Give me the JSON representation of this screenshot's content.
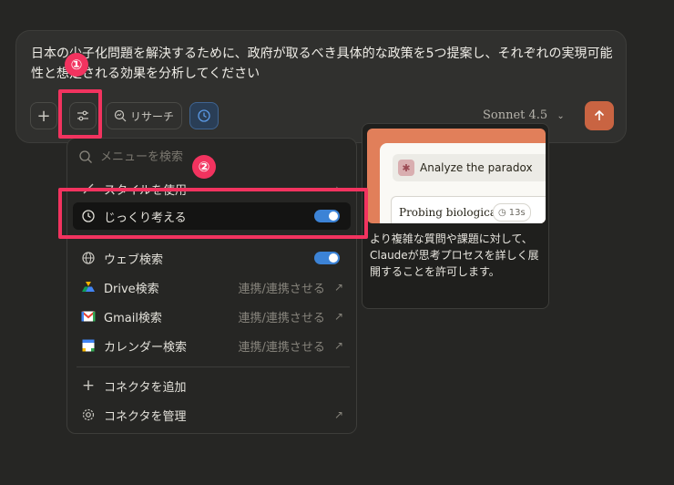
{
  "composer": {
    "prompt": "日本の少子化問題を解決するために、政府が取るべき具体的な政策を5つ提案し、それぞれの実現可能性と想定される効果を分析してください",
    "research_label": "リサーチ",
    "model_label": "Sonnet 4.5"
  },
  "menu": {
    "search_placeholder": "メニューを検索",
    "style_label": "スタイルを使用",
    "extended_thinking_label": "じっくり考える",
    "web_search_label": "ウェブ検索",
    "drive_label": "Drive検索",
    "gmail_label": "Gmail検索",
    "calendar_label": "カレンダー検索",
    "connect_label": "連携/連携させる",
    "add_connector_label": "コネクタを追加",
    "manage_connector_label": "コネクタを管理"
  },
  "tooltip": {
    "chip_text": "Analyze the paradox",
    "probe_text": "Probing biological",
    "timer": "13s",
    "description": "より複雑な質問や課題に対して、Claudeが思考プロセスを詳しく展開することを許可します。"
  },
  "annotations": {
    "badge1": "①",
    "badge2": "②",
    "color": "#f2335f"
  },
  "icons": [
    "plus-icon",
    "sliders-icon",
    "research-icon",
    "clock-icon",
    "chevron-down-icon",
    "arrow-up-icon",
    "search-icon",
    "brush-icon",
    "chevron-right-icon",
    "timer-icon",
    "globe-icon",
    "drive-icon",
    "gmail-icon",
    "calendar-icon",
    "external-link-icon",
    "gear-icon"
  ]
}
